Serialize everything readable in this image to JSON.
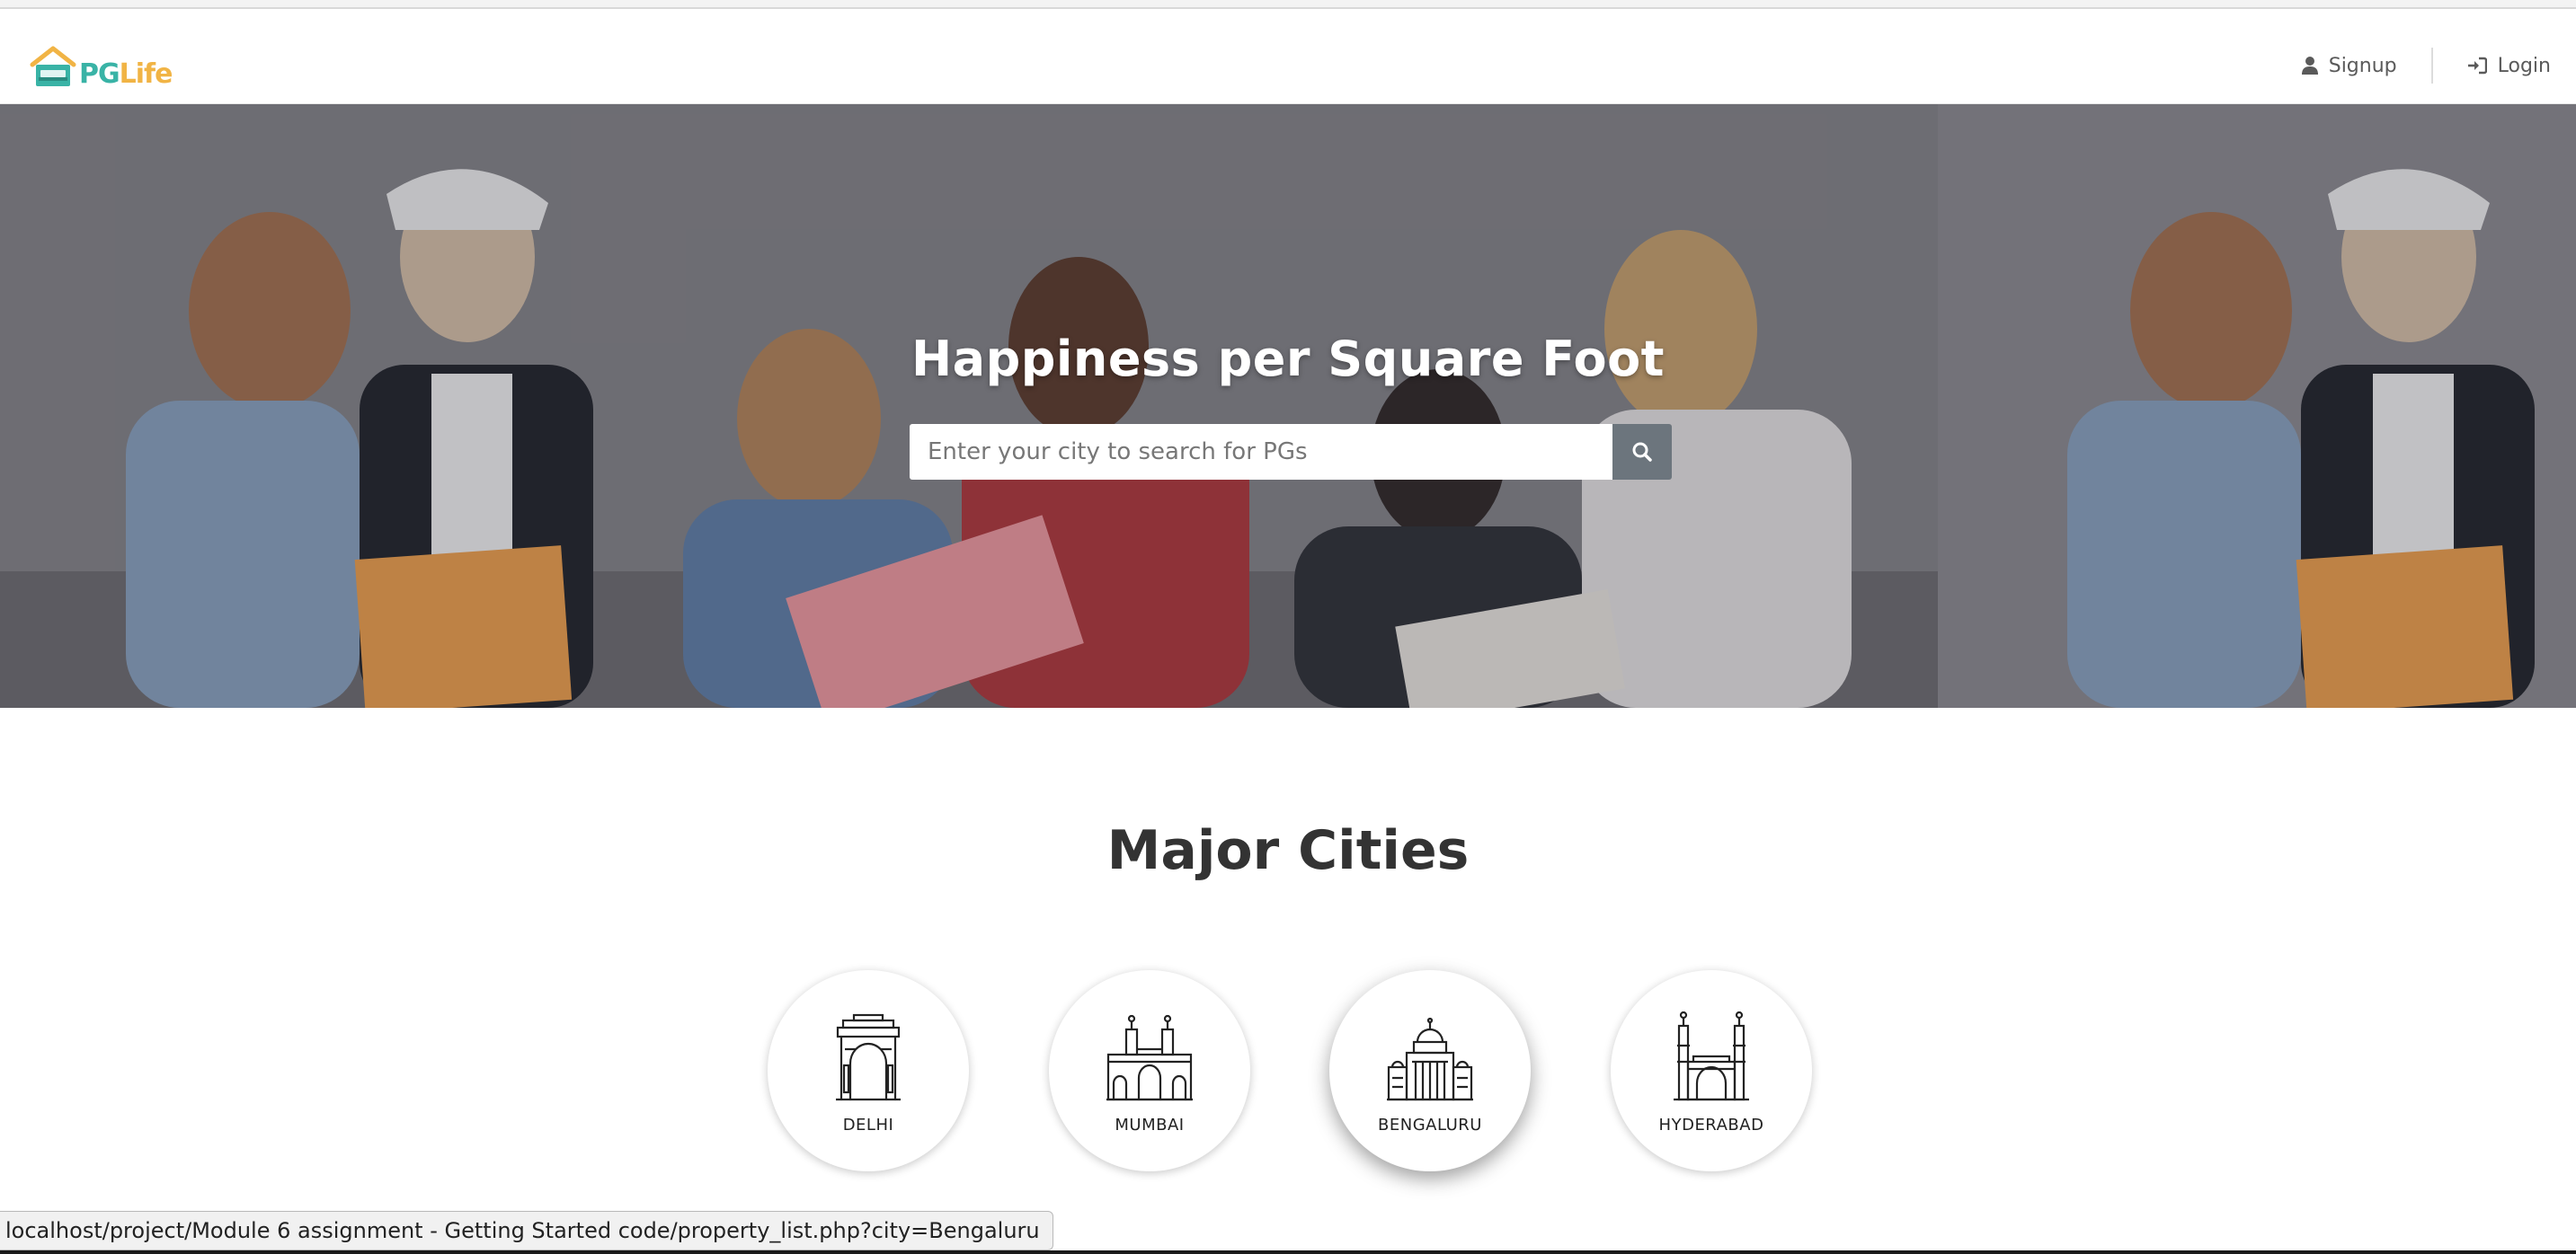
{
  "brand": {
    "name_part1": "PG",
    "name_part2": "Life",
    "accent": "#39b3a6",
    "accent2": "#f1b445"
  },
  "nav": {
    "signup_label": "Signup",
    "login_label": "Login",
    "signup_icon": "user-icon",
    "login_icon": "sign-in-icon"
  },
  "hero": {
    "title": "Happiness per Square Foot",
    "search_placeholder": "Enter your city to search for PGs",
    "search_icon": "search-icon"
  },
  "cities": {
    "title": "Major Cities",
    "items": [
      {
        "label": "DELHI",
        "icon": "india-gate-icon"
      },
      {
        "label": "MUMBAI",
        "icon": "gateway-of-india-icon"
      },
      {
        "label": "BENGALURU",
        "icon": "vidhana-soudha-icon"
      },
      {
        "label": "HYDERABAD",
        "icon": "charminar-icon"
      }
    ]
  },
  "status_bar": {
    "url": "localhost/project/Module 6 assignment - Getting Started code/property_list.php?city=Bengaluru"
  }
}
